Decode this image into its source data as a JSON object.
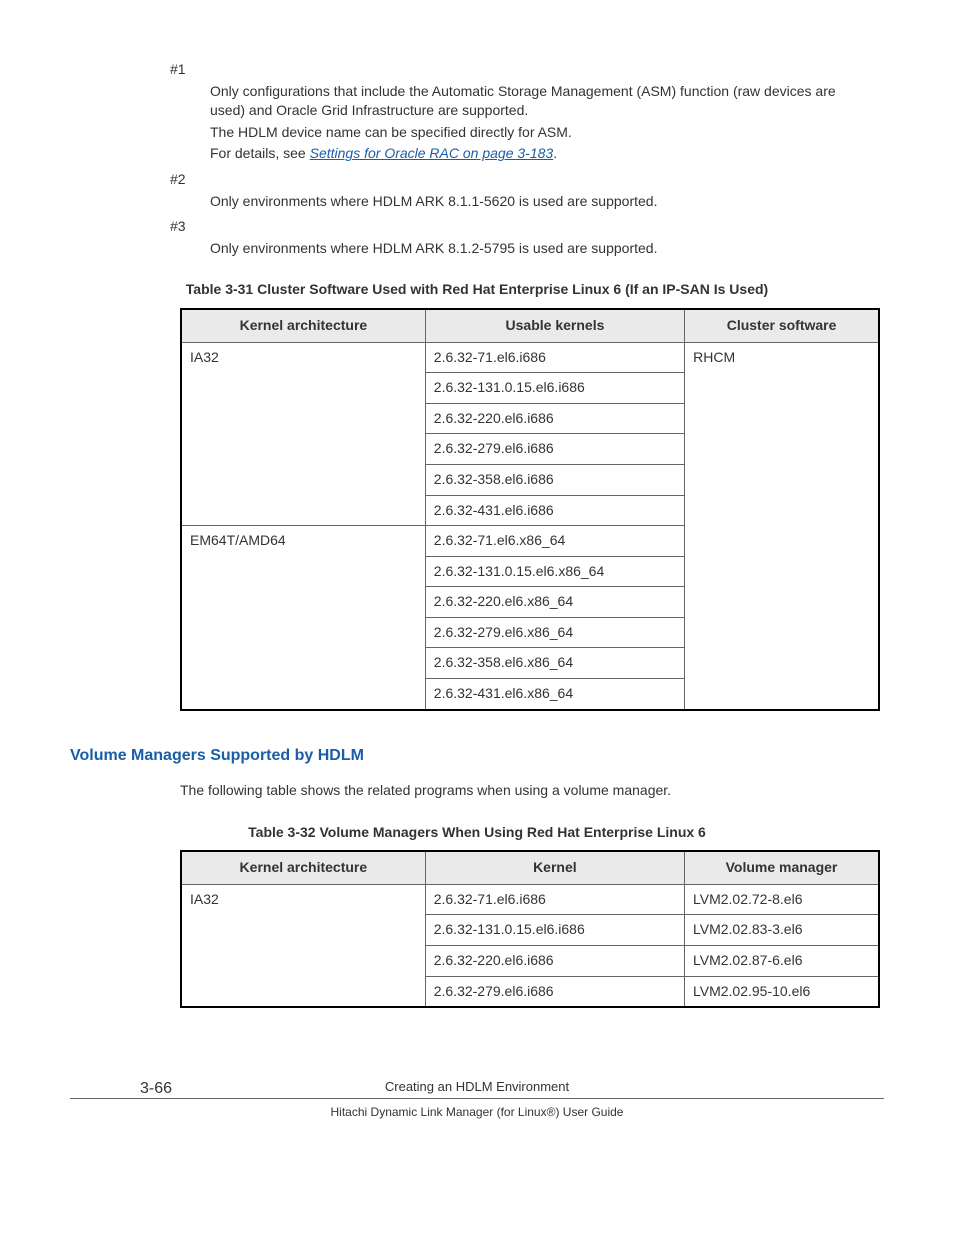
{
  "notes": {
    "n1": {
      "label": "#1",
      "p1": "Only configurations that include the Automatic Storage Management (ASM) function (raw devices are used) and Oracle Grid Infrastructure are supported.",
      "p2": "The HDLM device name can be specified directly for ASM.",
      "p3_prefix": "For details, see ",
      "p3_link": "Settings for Oracle RAC on page 3-183",
      "p3_suffix": "."
    },
    "n2": {
      "label": "#2",
      "p1": "Only environments where HDLM ARK 8.1.1-5620 is used are supported."
    },
    "n3": {
      "label": "#3",
      "p1": "Only environments where HDLM ARK 8.1.2-5795 is used are supported."
    }
  },
  "table31": {
    "caption": "Table 3-31 Cluster Software Used with Red Hat Enterprise Linux 6 (If an IP-SAN Is Used)",
    "headers": {
      "c1": "Kernel architecture",
      "c2": "Usable kernels",
      "c3": "Cluster software"
    },
    "arch1": "IA32",
    "arch1_kernels": [
      "2.6.32-71.el6.i686",
      "2.6.32-131.0.15.el6.i686",
      "2.6.32-220.el6.i686",
      "2.6.32-279.el6.i686",
      "2.6.32-358.el6.i686",
      "2.6.32-431.el6.i686"
    ],
    "arch2": "EM64T/AMD64",
    "arch2_kernels": [
      "2.6.32-71.el6.x86_64",
      "2.6.32-131.0.15.el6.x86_64",
      "2.6.32-220.el6.x86_64",
      "2.6.32-279.el6.x86_64",
      "2.6.32-358.el6.x86_64",
      "2.6.32-431.el6.x86_64"
    ],
    "cluster": "RHCM"
  },
  "section": {
    "heading": "Volume Managers Supported by HDLM",
    "para": "The following table shows the related programs when using a volume manager."
  },
  "table32": {
    "caption": "Table 3-32 Volume Managers When Using Red Hat Enterprise Linux 6",
    "headers": {
      "c1": "Kernel architecture",
      "c2": "Kernel",
      "c3": "Volume manager"
    },
    "arch1": "IA32",
    "rows": [
      {
        "kernel": "2.6.32-71.el6.i686",
        "vm": "LVM2.02.72-8.el6"
      },
      {
        "kernel": "2.6.32-131.0.15.el6.i686",
        "vm": "LVM2.02.83-3.el6"
      },
      {
        "kernel": "2.6.32-220.el6.i686",
        "vm": "LVM2.02.87-6.el6"
      },
      {
        "kernel": "2.6.32-279.el6.i686",
        "vm": "LVM2.02.95-10.el6"
      }
    ]
  },
  "footer": {
    "page": "3-66",
    "chapter": "Creating an HDLM Environment",
    "doc": "Hitachi Dynamic Link Manager (for Linux®) User Guide"
  }
}
